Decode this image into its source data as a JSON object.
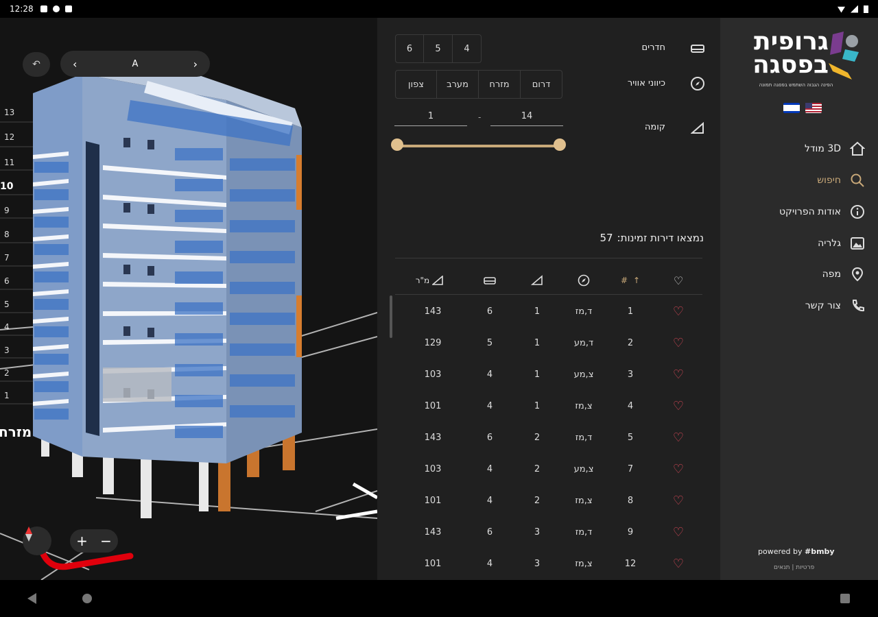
{
  "status": {
    "time": "12:28"
  },
  "viewer": {
    "floor_nav_label": "A",
    "prev_icon": "chevron-left-icon",
    "next_icon": "chevron-right-icon",
    "reset_icon": "undo-arrow-icon",
    "direction_label": "מזרח",
    "floors": [
      "13",
      "12",
      "11",
      "10",
      "9",
      "8",
      "7",
      "6",
      "5",
      "4",
      "3",
      "2",
      "1"
    ],
    "active_floor": "10",
    "zoom_in": "+",
    "zoom_out": "−"
  },
  "filters": {
    "rooms": {
      "label": "חדרים",
      "options": [
        "6",
        "5",
        "4"
      ]
    },
    "orientation": {
      "label": "כיווני אוויר",
      "options": [
        "צפון",
        "מערב",
        "מזרח",
        "דרום"
      ]
    },
    "floor": {
      "label": "קומה",
      "min": "1",
      "separator": "-",
      "max": "14"
    }
  },
  "results": {
    "title": "נמצאו דירות זמינות:",
    "count": "57",
    "columns": {
      "number": "#",
      "area": "מ\"ר"
    },
    "rows": [
      {
        "num": "1",
        "dir": "ד,מז",
        "floor": "1",
        "rooms": "6",
        "area": "143"
      },
      {
        "num": "2",
        "dir": "ד,מע",
        "floor": "1",
        "rooms": "5",
        "area": "129"
      },
      {
        "num": "3",
        "dir": "צ,מע",
        "floor": "1",
        "rooms": "4",
        "area": "103"
      },
      {
        "num": "4",
        "dir": "צ,מז",
        "floor": "1",
        "rooms": "4",
        "area": "101"
      },
      {
        "num": "5",
        "dir": "ד,מז",
        "floor": "2",
        "rooms": "6",
        "area": "143"
      },
      {
        "num": "7",
        "dir": "צ,מע",
        "floor": "2",
        "rooms": "4",
        "area": "103"
      },
      {
        "num": "8",
        "dir": "צ,מז",
        "floor": "2",
        "rooms": "4",
        "area": "101"
      },
      {
        "num": "9",
        "dir": "ד,מז",
        "floor": "3",
        "rooms": "6",
        "area": "143"
      },
      {
        "num": "12",
        "dir": "צ,מז",
        "floor": "3",
        "rooms": "4",
        "area": "101"
      }
    ]
  },
  "sidebar": {
    "logo_line1": "גרופית",
    "logo_line2": "בפסגה",
    "logo_sub": "הפינה הגבוה השתמש בפסגה תמונה",
    "nav": [
      {
        "label": "3D מודל",
        "icon": "home-icon",
        "name": "sidebar-item-3d-model"
      },
      {
        "label": "חיפוש",
        "icon": "search-icon",
        "name": "sidebar-item-search",
        "active": true
      },
      {
        "label": "אודות הפרויקט",
        "icon": "info-icon",
        "name": "sidebar-item-about"
      },
      {
        "label": "גלריה",
        "icon": "gallery-icon",
        "name": "sidebar-item-gallery"
      },
      {
        "label": "מפה",
        "icon": "map-pin-icon",
        "name": "sidebar-item-map"
      },
      {
        "label": "צור קשר",
        "icon": "phone-icon",
        "name": "sidebar-item-contact"
      }
    ],
    "powered_by": "powered by",
    "brand": "#bmby",
    "legal": "פרטיות | תנאים"
  },
  "colors": {
    "accent": "#c9a979",
    "heart": "#e04a5a",
    "panel": "#202020",
    "sidebar": "#2b2b2b"
  }
}
